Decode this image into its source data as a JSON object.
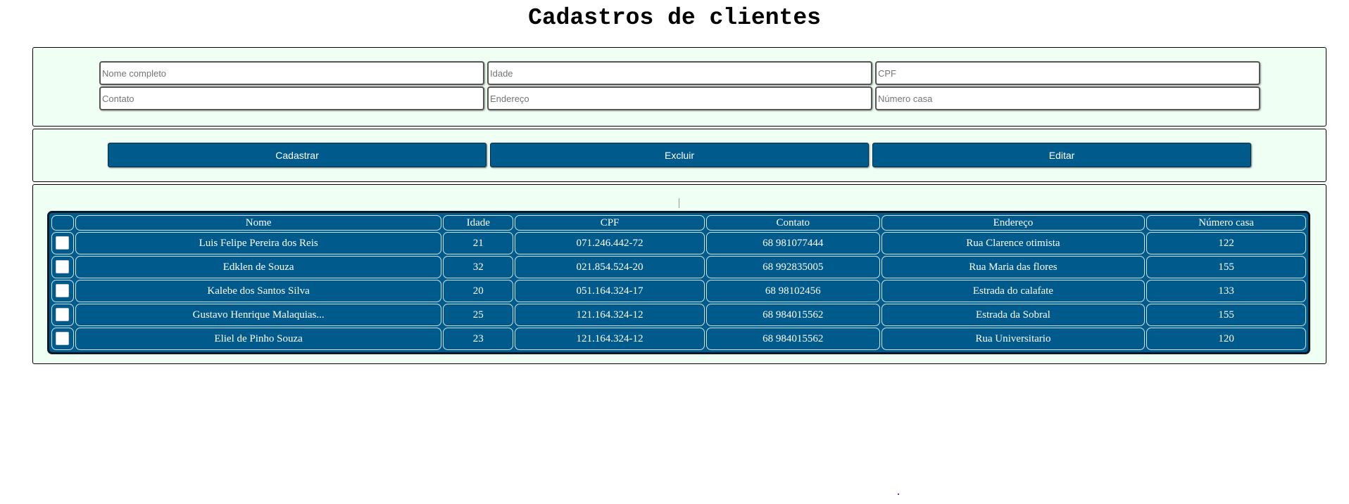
{
  "page": {
    "title": "Cadastros de clientes"
  },
  "form": {
    "fields": [
      {
        "name": "nome",
        "placeholder": "Nome completo",
        "value": ""
      },
      {
        "name": "idade",
        "placeholder": "Idade",
        "value": ""
      },
      {
        "name": "cpf",
        "placeholder": "CPF",
        "value": ""
      },
      {
        "name": "contato",
        "placeholder": "Contato",
        "value": ""
      },
      {
        "name": "endereco",
        "placeholder": "Endereço",
        "value": ""
      },
      {
        "name": "numero_casa",
        "placeholder": "Número casa",
        "value": ""
      }
    ]
  },
  "actions": {
    "cadastrar_label": "Cadastrar",
    "excluir_label": "Excluir",
    "editar_label": "Editar"
  },
  "table": {
    "headers": [
      "",
      "Nome",
      "Idade",
      "CPF",
      "Contato",
      "Endereço",
      "Número casa"
    ],
    "rows": [
      {
        "checked": false,
        "nome": "Luis Felipe Pereira dos Reis",
        "idade": "21",
        "cpf": "071.246.442-72",
        "contato": "68 981077444",
        "endereco": "Rua Clarence otimista",
        "numero_casa": "122"
      },
      {
        "checked": false,
        "nome": "Edklen de Souza",
        "idade": "32",
        "cpf": "021.854.524-20",
        "contato": "68 992835005",
        "endereco": "Rua Maria das flores",
        "numero_casa": "155"
      },
      {
        "checked": false,
        "nome": "Kalebe dos Santos Silva",
        "idade": "20",
        "cpf": "051.164.324-17",
        "contato": "68 98102456",
        "endereco": "Estrada do calafate",
        "numero_casa": "133"
      },
      {
        "checked": false,
        "nome": "Gustavo Henrique Malaquias...",
        "idade": "25",
        "cpf": "121.164.324-12",
        "contato": "68 984015562",
        "endereco": "Estrada da Sobral",
        "numero_casa": "155"
      },
      {
        "checked": false,
        "nome": "Eliel de Pinho Souza",
        "idade": "23",
        "cpf": "121.164.324-12",
        "contato": "68 984015562",
        "endereco": "Rua Universitario",
        "numero_casa": "120"
      }
    ]
  },
  "colors": {
    "panel_bg": "#f0fff4",
    "accent": "#005b8c",
    "table_border": "#0c1a26"
  }
}
